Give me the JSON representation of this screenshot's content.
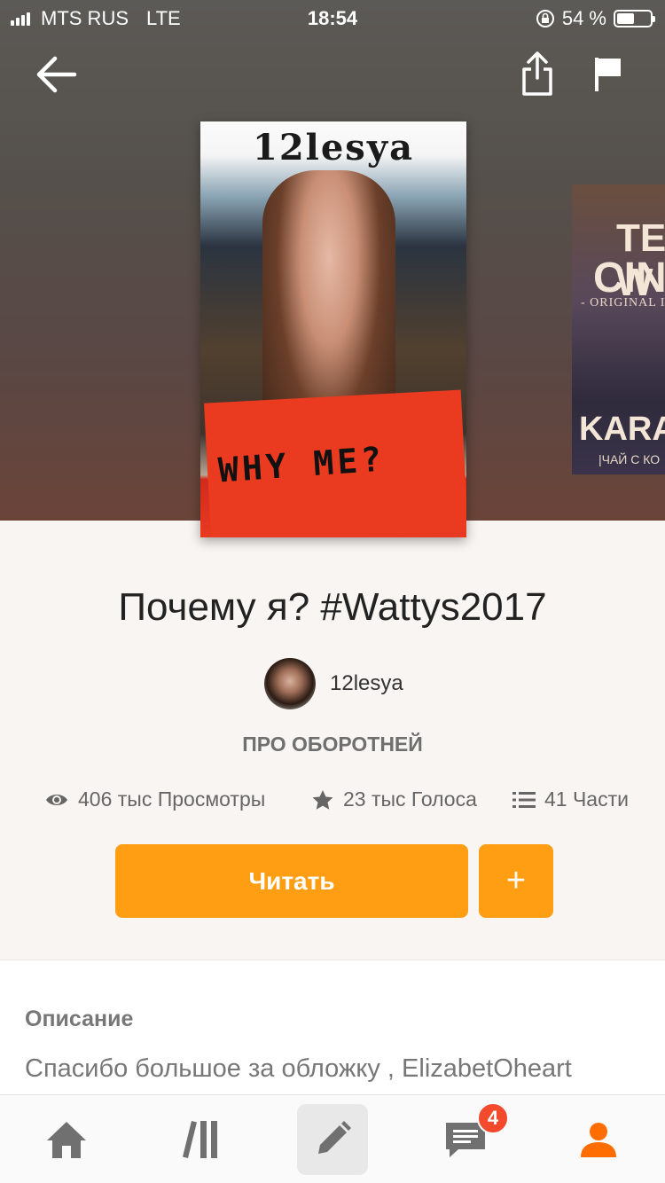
{
  "status_bar": {
    "carrier": "MTS RUS",
    "network": "LTE",
    "time": "18:54",
    "battery": "54 %",
    "battery_level": 0.54
  },
  "header": {
    "back_icon": "arrow-left-icon",
    "share_icon": "share-icon",
    "report_icon": "flag-icon"
  },
  "cover": {
    "author_text": "12lesya",
    "subtitle_text": "WHY ME?"
  },
  "next_cover": {
    "line1": "TEA W",
    "line2": "CINNA",
    "line3": "- ORIGINAL I",
    "line4": "KARA D",
    "line5": "|ЧАЙ С КО"
  },
  "story": {
    "title": "Почему я? #Wattys2017",
    "author": "12lesya",
    "category": "ПРО ОБОРОТНЕЙ"
  },
  "stats": {
    "views": "406 тыс Просмотры",
    "votes": "23 тыс Голоса",
    "parts": "41 Части"
  },
  "actions": {
    "read_label": "Читать",
    "add_label": "+"
  },
  "description": {
    "label": "Описание",
    "text": "Спасибо большое за обложку , ElizabetOheart"
  },
  "tabbar": {
    "items": [
      "home-icon",
      "library-icon",
      "write-icon",
      "messages-icon",
      "profile-icon"
    ],
    "messages_badge": "4",
    "accent_color": "#ff6d00"
  },
  "colors": {
    "primary_button": "#ff9e12",
    "badge": "#f3492c"
  }
}
